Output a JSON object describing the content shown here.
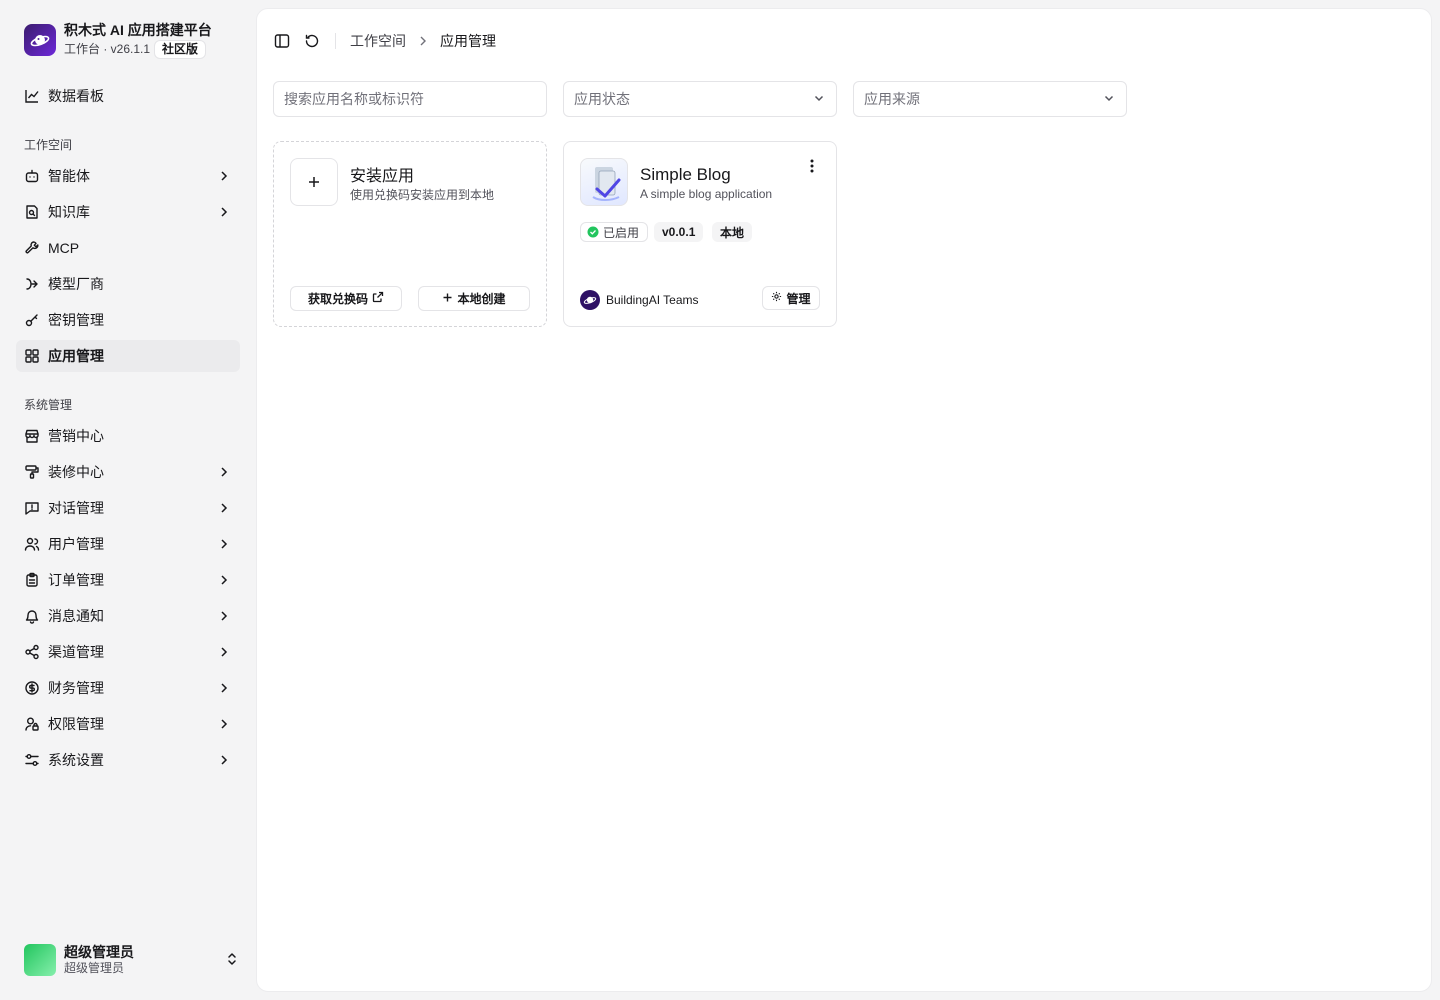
{
  "brand": {
    "title": "积木式 AI 应用搭建平台",
    "subtitle": "工作台 · v26.1.1",
    "badge": "社区版"
  },
  "sidebar": {
    "dashboard": "数据看板",
    "section_workspace": "工作空间",
    "workspace_items": [
      {
        "label": "智能体",
        "icon": "bot-icon",
        "expandable": true
      },
      {
        "label": "知识库",
        "icon": "book-search-icon",
        "expandable": true
      },
      {
        "label": "MCP",
        "icon": "wrench-icon",
        "expandable": false
      },
      {
        "label": "模型厂商",
        "icon": "model-provider-icon",
        "expandable": false
      },
      {
        "label": "密钥管理",
        "icon": "key-icon",
        "expandable": false
      },
      {
        "label": "应用管理",
        "icon": "grid-icon",
        "expandable": false,
        "active": true
      }
    ],
    "section_system": "系统管理",
    "system_items": [
      {
        "label": "营销中心",
        "icon": "store-icon",
        "expandable": false
      },
      {
        "label": "装修中心",
        "icon": "paint-roller-icon",
        "expandable": true
      },
      {
        "label": "对话管理",
        "icon": "message-alert-icon",
        "expandable": true
      },
      {
        "label": "用户管理",
        "icon": "users-icon",
        "expandable": true
      },
      {
        "label": "订单管理",
        "icon": "clipboard-icon",
        "expandable": true
      },
      {
        "label": "消息通知",
        "icon": "bell-icon",
        "expandable": true
      },
      {
        "label": "渠道管理",
        "icon": "share-icon",
        "expandable": true
      },
      {
        "label": "财务管理",
        "icon": "dollar-circle-icon",
        "expandable": true
      },
      {
        "label": "权限管理",
        "icon": "user-lock-icon",
        "expandable": true
      },
      {
        "label": "系统设置",
        "icon": "sliders-icon",
        "expandable": true
      }
    ],
    "user": {
      "name": "超级管理员",
      "role": "超级管理员"
    }
  },
  "breadcrumb": {
    "root": "工作空间",
    "current": "应用管理"
  },
  "filters": {
    "search_placeholder": "搜索应用名称或标识符",
    "status_placeholder": "应用状态",
    "source_placeholder": "应用来源"
  },
  "install_card": {
    "title": "安装应用",
    "desc": "使用兑换码安装应用到本地",
    "redeem_button": "获取兑换码",
    "local_create_button": "本地创建"
  },
  "app_card": {
    "title": "Simple Blog",
    "desc": "A simple blog application",
    "status": "已启用",
    "version": "v0.0.1",
    "source": "本地",
    "author": "BuildingAI Teams",
    "manage_button": "管理"
  },
  "colors": {
    "status_ok": "#22c55e",
    "active_bg": "#ebebed",
    "brand": "#4c1d95"
  }
}
